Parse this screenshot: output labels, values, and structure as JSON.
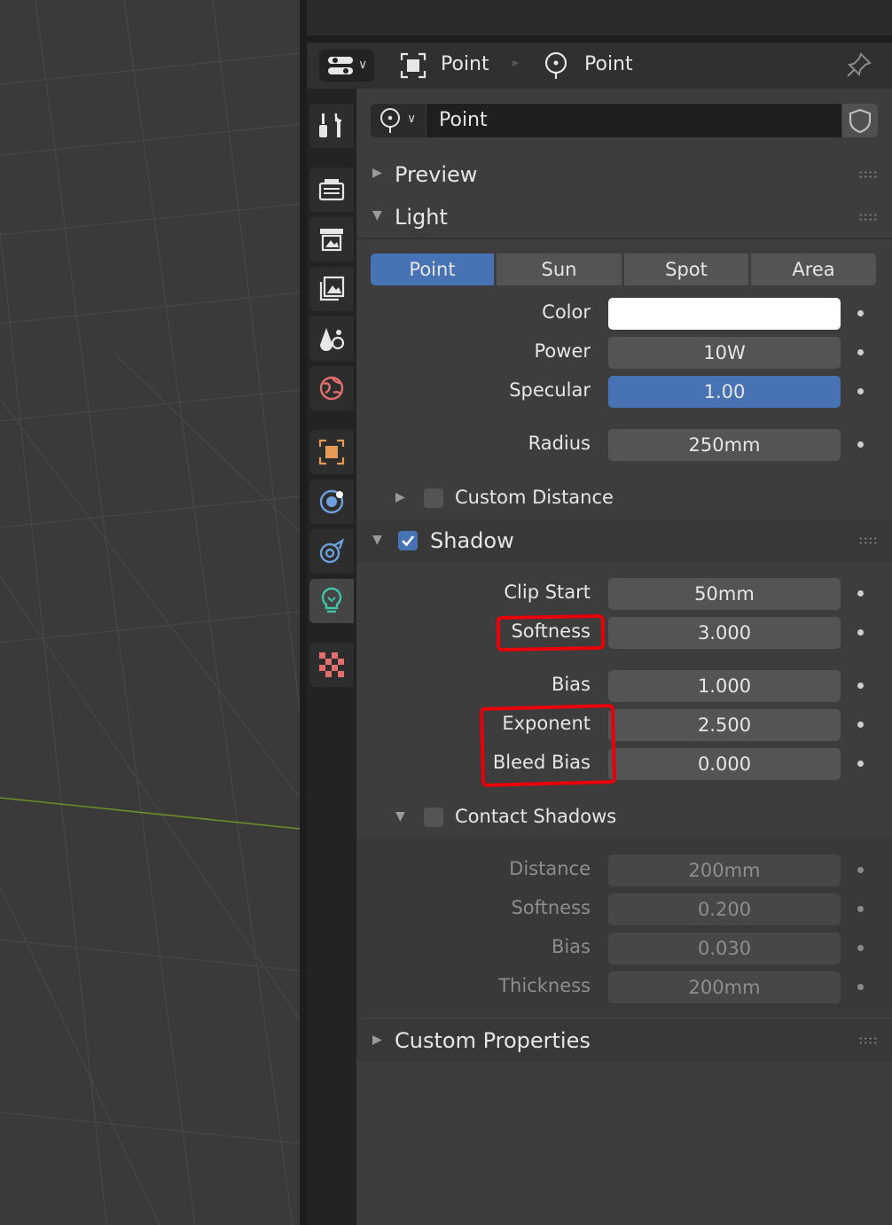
{
  "header": {
    "context_object": "Point",
    "context_data": "Point"
  },
  "datablock": {
    "name": "Point"
  },
  "sections": {
    "preview": "Preview",
    "light": "Light",
    "shadow": "Shadow",
    "custom_properties": "Custom Properties"
  },
  "light_types": [
    "Point",
    "Sun",
    "Spot",
    "Area"
  ],
  "light_type_selected": "Point",
  "light_fields": {
    "color_label": "Color",
    "color_value": "#ffffff",
    "power_label": "Power",
    "power_value": "10W",
    "specular_label": "Specular",
    "specular_value": "1.00",
    "radius_label": "Radius",
    "radius_value": "250mm",
    "custom_distance_label": "Custom Distance"
  },
  "shadow_fields": {
    "clip_start_label": "Clip Start",
    "clip_start_value": "50mm",
    "softness_label": "Softness",
    "softness_value": "3.000",
    "bias_label": "Bias",
    "bias_value": "1.000",
    "exponent_label": "Exponent",
    "exponent_value": "2.500",
    "bleed_bias_label": "Bleed Bias",
    "bleed_bias_value": "0.000"
  },
  "contact_shadows": {
    "title": "Contact Shadows",
    "distance_label": "Distance",
    "distance_value": "200mm",
    "softness_label": "Softness",
    "softness_value": "0.200",
    "bias_label": "Bias",
    "bias_value": "0.030",
    "thickness_label": "Thickness",
    "thickness_value": "200mm"
  },
  "checkbox_states": {
    "custom_distance": false,
    "shadow": true,
    "contact_shadows": false
  },
  "tabs": [
    "tool-icon",
    "render-icon",
    "output-icon",
    "view-layer-icon",
    "scene-icon",
    "world-icon",
    "object-icon",
    "physics-icon",
    "constraints-icon",
    "light-data-icon",
    "texture-icon"
  ],
  "active_tab": "light-data-icon",
  "colors": {
    "accent": "#4772b3",
    "highlight_marker": "#e8000a",
    "active_tab_icon": "#3fc6a8"
  }
}
